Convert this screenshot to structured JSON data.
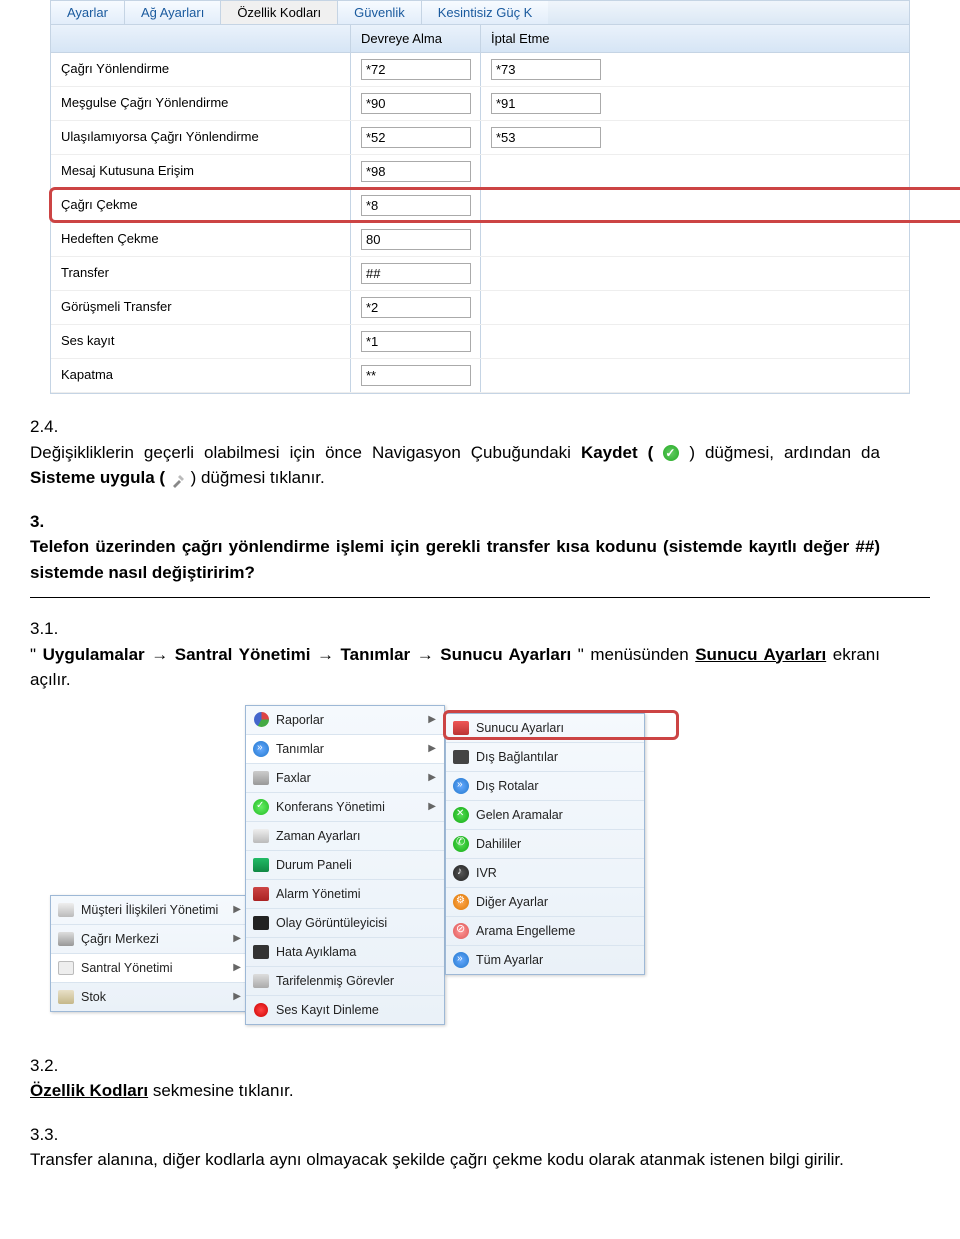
{
  "form": {
    "tabs": [
      "Ayarlar",
      "Ağ Ayarları",
      "Özellik Kodları",
      "Güvenlik",
      "Kesintisiz Güç K"
    ],
    "active_tab_index": 2,
    "headers": {
      "col1": "",
      "col2": "Devreye Alma",
      "col3": "İptal Etme"
    },
    "rows": [
      {
        "label": "Çağrı Yönlendirme",
        "v1": "*72",
        "v2": "*73"
      },
      {
        "label": "Meşgulse Çağrı Yönlendirme",
        "v1": "*90",
        "v2": "*91"
      },
      {
        "label": "Ulaşılamıyorsa Çağrı Yönlendirme",
        "v1": "*52",
        "v2": "*53"
      },
      {
        "label": "Mesaj Kutusuna Erişim",
        "v1": "*98",
        "v2": ""
      },
      {
        "label": "Çağrı Çekme",
        "v1": "*8",
        "v2": "",
        "highlight": true
      },
      {
        "label": "Hedeften Çekme",
        "v1": "80",
        "v2": ""
      },
      {
        "label": "Transfer",
        "v1": "##",
        "v2": ""
      },
      {
        "label": "Görüşmeli Transfer",
        "v1": "*2",
        "v2": ""
      },
      {
        "label": "Ses kayıt",
        "v1": "*1",
        "v2": ""
      },
      {
        "label": "Kapatma",
        "v1": "**",
        "v2": ""
      }
    ]
  },
  "text": {
    "p24_num": "2.4.",
    "p24_a": "Değişikliklerin geçerli olabilmesi için önce Navigasyon Çubuğundaki ",
    "p24_kaydet": "Kaydet (",
    "p24_b": " ) düğmesi, ardından da ",
    "p24_sisteme": "Sisteme uygula (",
    "p24_c": ") düğmesi tıklanır.",
    "p3_num": "3.",
    "p3_body": "Telefon üzerinden çağrı yönlendirme işlemi için gerekli transfer kısa kodunu (sistemde kayıtlı değer ##) sistemde nasıl değiştiririm?",
    "p31_num": "3.1.",
    "p31_a": "\"",
    "p31_uyg": "Uygulamalar → Santral Yönetimi → Tanımlar → Sunucu Ayarları",
    "p31_b": "\" menüsünden ",
    "p31_ekran": "Sunucu Ayarları",
    "p31_c": " ekranı açılır.",
    "p32_num": "3.2.",
    "p32_body": "Özellik Kodları",
    "p32_rest": " sekmesine tıklanır.",
    "p33_num": "3.3.",
    "p33_a": "Transfer alanına, diğer kodlarla aynı olmayacak şekilde çağrı çekme kodu olarak atanmak istenen bilgi girilir."
  },
  "menu1": [
    {
      "label": "Müşteri İlişkileri Yönetimi",
      "icon": "sq-user",
      "arrow": true
    },
    {
      "label": "Çağrı Merkezi",
      "icon": "sq-head",
      "arrow": true
    },
    {
      "label": "Santral Yönetimi",
      "icon": "sq-gear",
      "arrow": true,
      "selected": true
    },
    {
      "label": "Stok",
      "icon": "sq-box",
      "arrow": true
    }
  ],
  "menu2": [
    {
      "label": "Raporlar",
      "icon": "sq-pie",
      "arrow": true
    },
    {
      "label": "Tanımlar",
      "icon": "c-blue",
      "arrow": true,
      "selected": true
    },
    {
      "label": "Faxlar",
      "icon": "sq-fax",
      "arrow": true
    },
    {
      "label": "Konferans Yönetimi",
      "icon": "c-green",
      "arrow": true
    },
    {
      "label": "Zaman Ayarları",
      "icon": "sq-tools",
      "arrow": false
    },
    {
      "label": "Durum Paneli",
      "icon": "sq-panel",
      "arrow": false
    },
    {
      "label": "Alarm Yönetimi",
      "icon": "sq-alarm",
      "arrow": false
    },
    {
      "label": "Olay Görüntüleyicisi",
      "icon": "sq-eye",
      "arrow": false
    },
    {
      "label": "Hata Ayıklama",
      "icon": "sq-bug",
      "arrow": false
    },
    {
      "label": "Tarifelenmiş Görevler",
      "icon": "sq-task",
      "arrow": false
    },
    {
      "label": "Ses Kayıt Dinleme",
      "icon": "sq-rec",
      "arrow": false
    }
  ],
  "menu3": [
    {
      "label": "Sunucu Ayarları",
      "icon": "sq-paint",
      "highlight": true
    },
    {
      "label": "Dış Bağlantılar",
      "icon": "sq-plug"
    },
    {
      "label": "Dış Rotalar",
      "icon": "c-blue"
    },
    {
      "label": "Gelen Aramalar",
      "icon": "c-grn2"
    },
    {
      "label": "Dahililer",
      "icon": "c-phone"
    },
    {
      "label": "IVR",
      "icon": "c-blk"
    },
    {
      "label": "Diğer Ayarlar",
      "icon": "c-ora"
    },
    {
      "label": "Arama Engelleme",
      "icon": "c-stop"
    },
    {
      "label": "Tüm Ayarlar",
      "icon": "c-blue"
    }
  ]
}
